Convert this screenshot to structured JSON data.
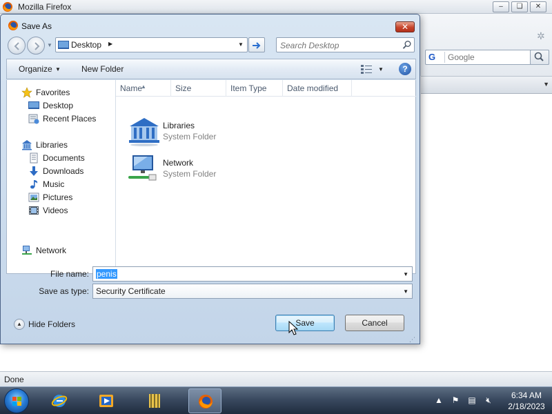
{
  "firefox": {
    "title": "Mozilla Firefox",
    "minimize_label": "–",
    "restore_label": "❏",
    "close_label": "✕",
    "search_engine": "G",
    "search_placeholder": "Google",
    "status": "Done"
  },
  "dialog": {
    "title": "Save As",
    "close_label": "✕",
    "address": {
      "location": "Desktop"
    },
    "search_placeholder": "Search Desktop",
    "toolbar": {
      "organize_label": "Organize",
      "new_folder_label": "New Folder",
      "help_label": "?"
    },
    "nav_pane": {
      "favorites": [
        {
          "label": "Favorites",
          "icon": "star-icon"
        },
        {
          "label": "Desktop",
          "icon": "desktop-icon"
        },
        {
          "label": "Recent Places",
          "icon": "recent-places-icon"
        }
      ],
      "libraries": [
        {
          "label": "Libraries",
          "icon": "libraries-icon"
        },
        {
          "label": "Documents",
          "icon": "documents-icon"
        },
        {
          "label": "Downloads",
          "icon": "downloads-icon"
        },
        {
          "label": "Music",
          "icon": "music-icon"
        },
        {
          "label": "Pictures",
          "icon": "pictures-icon"
        },
        {
          "label": "Videos",
          "icon": "videos-icon"
        }
      ],
      "network": {
        "label": "Network",
        "icon": "network-icon"
      }
    },
    "columns": [
      "Name",
      "Size",
      "Item Type",
      "Date modified"
    ],
    "items": [
      {
        "name": "Libraries",
        "type": "System Folder",
        "icon": "libraries-folder-icon"
      },
      {
        "name": "Network",
        "type": "System Folder",
        "icon": "network-folder-icon"
      }
    ],
    "file_name_label": "File name:",
    "file_name_value": "penis",
    "save_type_label": "Save as type:",
    "save_type_value": "Security Certificate",
    "hide_folders_label": "Hide Folders",
    "save_label": "Save",
    "cancel_label": "Cancel"
  },
  "taskbar": {
    "apps": [
      {
        "name": "Internet Explorer",
        "icon": "internet-explorer-icon"
      },
      {
        "name": "Windows Media Player",
        "icon": "media-player-icon"
      },
      {
        "name": "Library",
        "icon": "library-icon"
      },
      {
        "name": "Firefox",
        "icon": "firefox-icon",
        "active": true
      }
    ],
    "clock_time": "6:34 AM",
    "clock_date": "2/18/2023"
  },
  "colors": {
    "accent": "#3399ff",
    "dialog_frame": "#c3d5e9",
    "taskbar": "#2b3b52"
  }
}
